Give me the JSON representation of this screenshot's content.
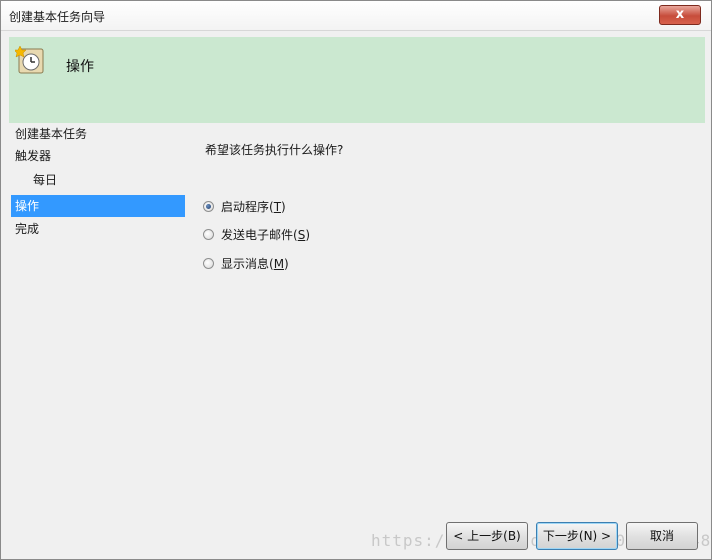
{
  "window": {
    "title": "创建基本任务向导",
    "close_label": "x"
  },
  "header": {
    "title": "操作",
    "icon": "task-scheduler-clock-icon",
    "background": "#cbe8d0"
  },
  "nav": {
    "items": [
      {
        "label": "创建基本任务"
      },
      {
        "label": "触发器"
      },
      {
        "label": "每日"
      },
      {
        "label": "操作"
      },
      {
        "label": "完成"
      }
    ],
    "selected_color": "#3399ff"
  },
  "content": {
    "question": "希望该任务执行什么操作?",
    "options": [
      {
        "label": "启动程序(",
        "key": "T",
        "suffix": ")",
        "checked": true
      },
      {
        "label": "发送电子邮件(",
        "key": "S",
        "suffix": ")",
        "checked": false
      },
      {
        "label": "显示消息(",
        "key": "M",
        "suffix": ")",
        "checked": false
      }
    ]
  },
  "buttons": {
    "back": "< 上一步(B)",
    "next": "下一步(N) >",
    "cancel": "取消"
  },
  "watermark": "https://blog.csdn.net/u011774548"
}
